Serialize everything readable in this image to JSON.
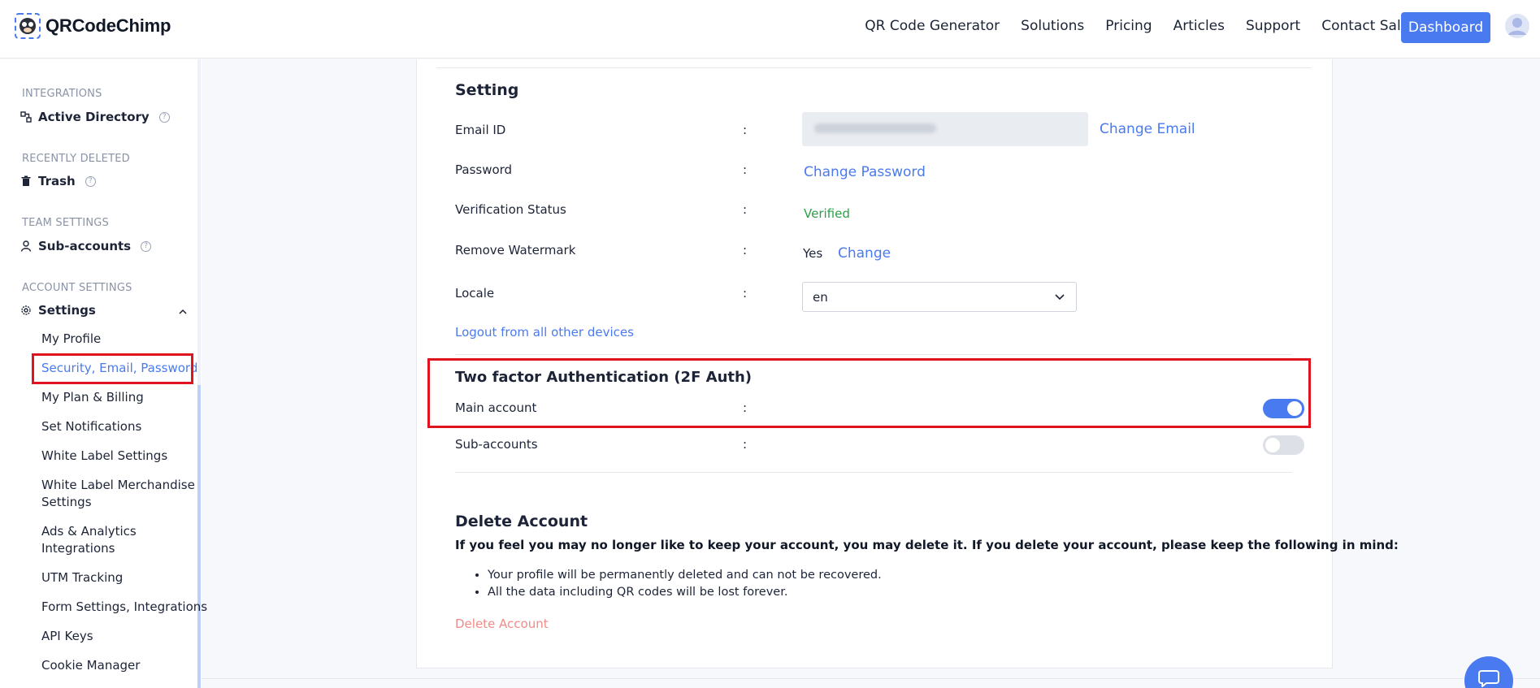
{
  "header": {
    "logo_text": "QRCodeChimp",
    "nav": [
      "QR Code Generator",
      "Solutions",
      "Pricing",
      "Articles",
      "Support",
      "Contact Sales"
    ],
    "dashboard_label": "Dashboard"
  },
  "sidebar": {
    "integrations_title": "INTEGRATIONS",
    "active_directory": "Active Directory",
    "recently_deleted_title": "RECENTLY DELETED",
    "trash": "Trash",
    "team_settings_title": "TEAM SETTINGS",
    "sub_accounts": "Sub-accounts",
    "account_settings_title": "ACCOUNT SETTINGS",
    "settings": "Settings",
    "items": [
      "My Profile",
      "Security, Email, Password",
      "My Plan & Billing",
      "Set Notifications",
      "White Label Settings",
      "White Label Merchandise Settings",
      "Ads & Analytics Integrations",
      "UTM Tracking",
      "Form Settings, Integrations",
      "API Keys",
      "Cookie Manager"
    ],
    "help_glyph": "?"
  },
  "setting": {
    "title": "Setting",
    "colon": ":",
    "email_label": "Email ID",
    "change_email": "Change Email",
    "password_label": "Password",
    "change_password": "Change Password",
    "verification_label": "Verification Status",
    "verification_value": "Verified",
    "watermark_label": "Remove Watermark",
    "watermark_value": "Yes",
    "watermark_change": "Change",
    "locale_label": "Locale",
    "locale_value": "en",
    "logout_all": "Logout from all other devices"
  },
  "two_factor": {
    "title": "Two factor Authentication (2F Auth)",
    "main_account_label": "Main account",
    "main_account_enabled": true,
    "sub_accounts_label": "Sub-accounts",
    "sub_accounts_enabled": false
  },
  "delete": {
    "title": "Delete Account",
    "warning": "If you feel you may no longer like to keep your account, you may delete it. If you delete your account, please keep the following in mind:",
    "bullets": [
      "Your profile will be permanently deleted and can not be recovered.",
      "All the data including QR codes will be lost forever."
    ],
    "button": "Delete Account"
  },
  "colors": {
    "accent": "#4a7af0",
    "highlight": "#e0141f",
    "verified": "#2aa148",
    "danger_link": "#f08b88"
  }
}
